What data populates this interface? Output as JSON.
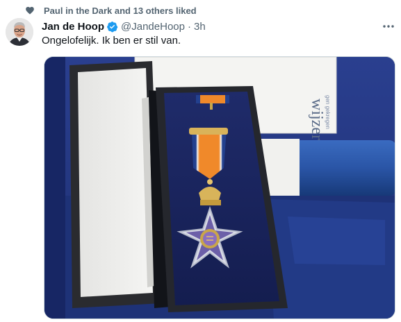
{
  "social_context": {
    "text": "Paul in the Dark and 13 others liked",
    "icon": "heart-icon"
  },
  "author": {
    "display_name": "Jan de Hoop",
    "handle": "@JandeHoop",
    "time": "3h",
    "verified": true
  },
  "tweet": {
    "text": "Ongelofelijk. Ik ben er stil van."
  },
  "more_icon": "more-icon",
  "media": {
    "kind": "photo",
    "visible_text": {
      "box_text": "wijzer",
      "box_text_small": "gen gekregen"
    }
  },
  "colors": {
    "secondary_text": "#536471",
    "verified_blue": "#1d9bf0",
    "ribbon_orange": "#f0892a",
    "ribbon_blue": "#23408e",
    "velvet_navy": "#1d2a63"
  }
}
